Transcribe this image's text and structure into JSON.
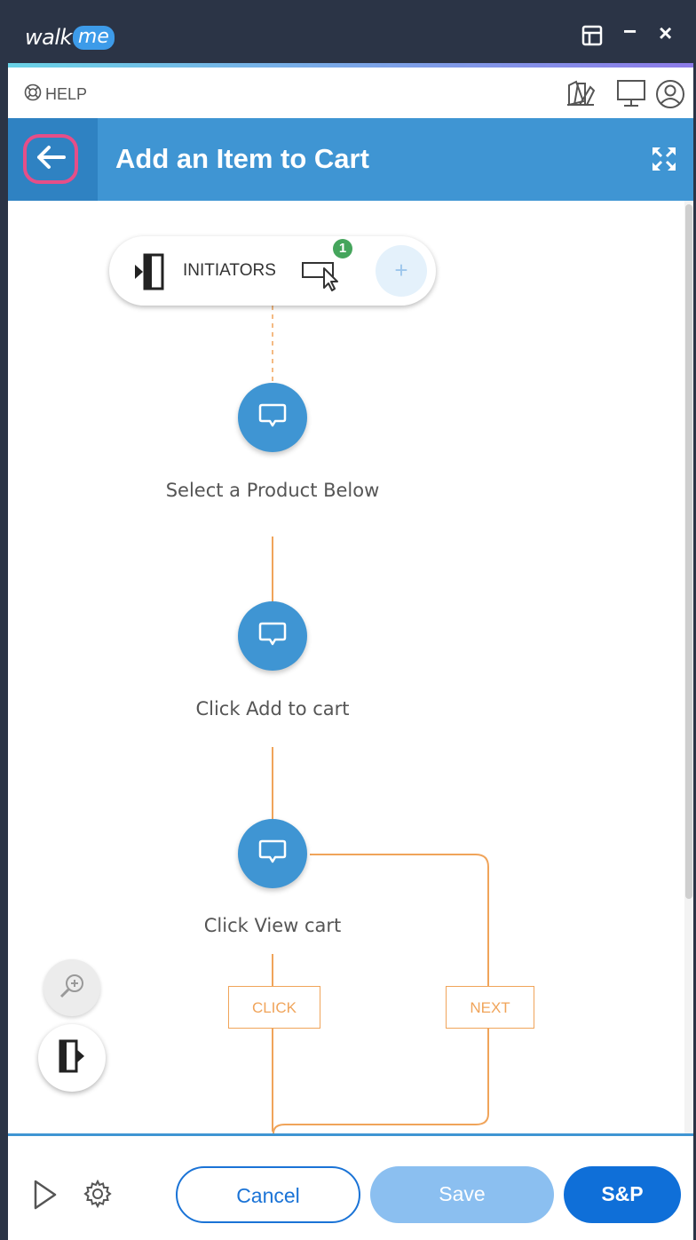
{
  "app": {
    "logo_walk": "walk",
    "logo_me": "me"
  },
  "window_controls": {
    "minimize": "−",
    "close": "×"
  },
  "helpbar": {
    "help_label": "HELP"
  },
  "header": {
    "title": "Add an Item to Cart"
  },
  "flow": {
    "initiators_label": "INITIATORS",
    "initiators_count": "1",
    "add_label": "+",
    "steps": [
      {
        "label": "Select a Product Below"
      },
      {
        "label": "Click Add to cart"
      },
      {
        "label": "Click View cart"
      }
    ],
    "branches": [
      {
        "label": "CLICK"
      },
      {
        "label": "NEXT"
      }
    ]
  },
  "footer": {
    "cancel_label": "Cancel",
    "save_label": "Save",
    "sp_label": "S&P"
  },
  "colors": {
    "titlebar": "#2b3446",
    "header": "#3f95d3",
    "step": "#3f95d3",
    "branch": "#f0a45a",
    "highlight": "#e64e88",
    "primary": "#0f6fd8"
  },
  "icons": [
    "walkme-logo",
    "layout-icon",
    "minimize-icon",
    "close-icon",
    "lifebuoy-icon",
    "swatch-icon",
    "monitor-icon",
    "user-icon",
    "back-arrow-icon",
    "expand-icon",
    "initiator-door-icon",
    "cursor-icon",
    "balloon-icon",
    "zoom-in-icon",
    "exit-door-icon",
    "play-icon",
    "gear-icon"
  ]
}
